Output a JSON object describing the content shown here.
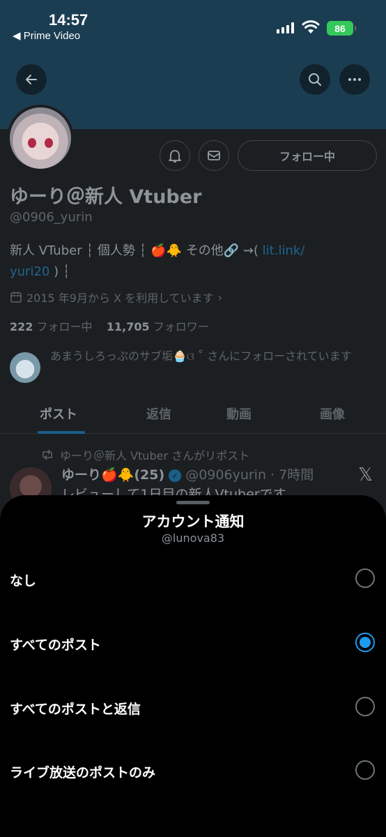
{
  "status_bar": {
    "time": "14:57",
    "back_app": "◀ Prime Video",
    "battery": "86"
  },
  "profile": {
    "follow_button": "フォロー中",
    "display_name": "ゆーり＠新人 Vtuber",
    "handle": "@0906_yurin",
    "bio_text": "新人 VTuber ┆ 個人勢 ┆ 🍎🐥 その他🔗 ⇝( ",
    "bio_link_1": "lit.link/",
    "bio_link_2": "yuri20",
    "bio_end": " ) ┆",
    "joined": "2015 年9月から X を利用しています",
    "following_count": "222",
    "following_label": "フォロー中",
    "followers_count": "11,705",
    "followers_label": "フォロワー",
    "followed_by": "あまうしろっぷのサブ垢🧁ଓ ˚ さんにフォローされています"
  },
  "tabs": [
    {
      "label": "ポスト",
      "active": true
    },
    {
      "label": "返信"
    },
    {
      "label": "動画"
    },
    {
      "label": "画像"
    }
  ],
  "post": {
    "repost_text": "ゆーり＠新人 Vtuber さんがリポスト",
    "author": "ゆーり🍎🐥(25)",
    "meta": "@0906yurin · 7時間",
    "text": "レビューして1日目の新人Vtuberです"
  },
  "sheet": {
    "title": "アカウント通知",
    "subtitle": "@lunova83",
    "options": [
      {
        "label": "なし",
        "selected": false
      },
      {
        "label": "すべてのポスト",
        "selected": true
      },
      {
        "label": "すべてのポストと返信",
        "selected": false
      },
      {
        "label": "ライブ放送のポストのみ",
        "selected": false
      }
    ]
  },
  "colors": {
    "accent": "#1d9bf0",
    "banner": "#1b3d52"
  }
}
